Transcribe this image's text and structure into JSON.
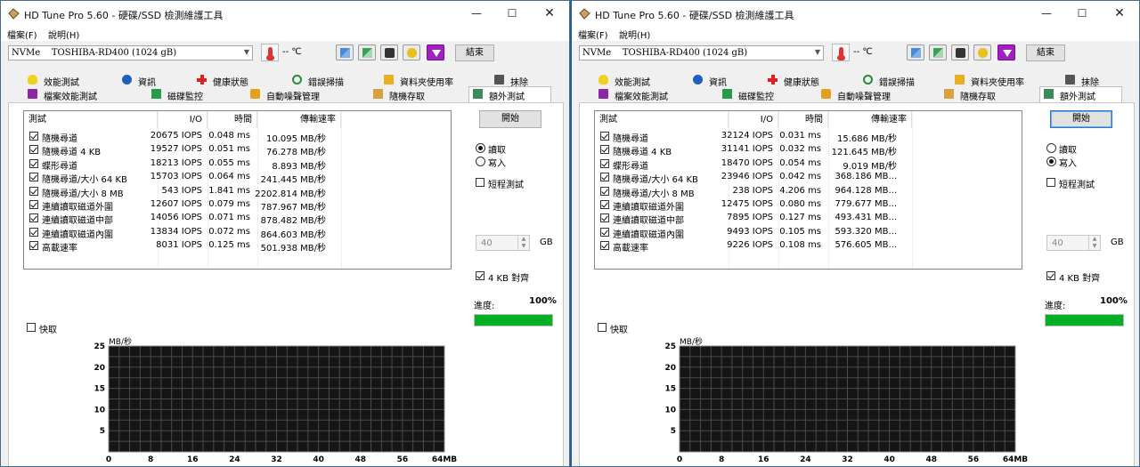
{
  "windows": [
    {
      "title": "HD Tune Pro 5.60 - 硬碟/SSD 檢測維護工具",
      "window_controls": {
        "minimize": "—",
        "maximize": "☐",
        "close": "✕"
      },
      "menu": [
        "檔案(F)",
        "說明(H)"
      ],
      "drive": "NVMe    TOSHIBA-RD400 (1024 gB)",
      "temperature": "-- ℃",
      "exit_label": "結束",
      "tabs_row1": [
        {
          "label": "效能測試",
          "icon": "bulb-icon"
        },
        {
          "label": "資訊",
          "icon": "info-icon"
        },
        {
          "label": "健康狀態",
          "icon": "health-cross-icon"
        },
        {
          "label": "錯誤掃描",
          "icon": "magnifier-icon"
        },
        {
          "label": "資料夾使用率",
          "icon": "folder-icon"
        },
        {
          "label": "抹除",
          "icon": "trash-icon"
        }
      ],
      "tabs_row2": [
        {
          "label": "檔案效能測試",
          "icon": "file-benchmark-icon"
        },
        {
          "label": "磁碟監控",
          "icon": "disk-monitor-icon"
        },
        {
          "label": "自動噪聲管理",
          "icon": "speaker-icon"
        },
        {
          "label": "隨機存取",
          "icon": "random-access-icon"
        },
        {
          "label": "額外測試",
          "icon": "extra-tests-icon",
          "active": true
        }
      ],
      "table": {
        "headers": [
          "測試",
          "I/O",
          "時間",
          "傳輸速率"
        ],
        "rows": [
          {
            "name": "隨機尋道",
            "io": "20675 IOPS",
            "time": "0.048 ms",
            "rate": "10.095 MB/秒",
            "checked": true
          },
          {
            "name": "隨機尋道 4 KB",
            "io": "19527 IOPS",
            "time": "0.051 ms",
            "rate": "76.278 MB/秒",
            "checked": true
          },
          {
            "name": "蝶形尋道",
            "io": "18213 IOPS",
            "time": "0.055 ms",
            "rate": "8.893 MB/秒",
            "checked": true
          },
          {
            "name": "隨機尋道/大小 64 KB",
            "io": "15703 IOPS",
            "time": "0.064 ms",
            "rate": "241.445 MB/秒",
            "checked": true
          },
          {
            "name": "隨機尋道/大小 8 MB",
            "io": "543 IOPS",
            "time": "1.841 ms",
            "rate": "2202.814 MB/秒",
            "checked": true
          },
          {
            "name": "連續讀取磁道外圍",
            "io": "12607 IOPS",
            "time": "0.079 ms",
            "rate": "787.967 MB/秒",
            "checked": true
          },
          {
            "name": "連續讀取磁道中部",
            "io": "14056 IOPS",
            "time": "0.071 ms",
            "rate": "878.482 MB/秒",
            "checked": true
          },
          {
            "name": "連續讀取磁道內圍",
            "io": "13834 IOPS",
            "time": "0.072 ms",
            "rate": "864.603 MB/秒",
            "checked": true
          },
          {
            "name": "高載速率",
            "io": "8031 IOPS",
            "time": "0.125 ms",
            "rate": "501.938 MB/秒",
            "checked": true
          }
        ]
      },
      "start_label": "開始",
      "start_focused": false,
      "read_label": "讀取",
      "write_label": "寫入",
      "mode": "read",
      "short_test_label": "短程測試",
      "short_test_checked": false,
      "size_value": "40",
      "size_unit": "GB",
      "align_label": "4 KB 對齊",
      "align_checked": true,
      "progress_label": "進度:",
      "progress_text": "100%",
      "progress_fraction": 1.0,
      "quick_label": "快取",
      "quick_checked": false,
      "chart_data": {
        "type": "line",
        "ylabel": "MB/秒",
        "xlabel": "",
        "x_tick_labels": [
          "0",
          "8",
          "16",
          "24",
          "32",
          "40",
          "48",
          "56",
          "64MB"
        ],
        "y_tick_labels": [
          "5",
          "10",
          "15",
          "20",
          "25"
        ],
        "ylim": [
          0,
          25
        ],
        "xlim": [
          0,
          64
        ],
        "grid": true,
        "series": []
      }
    },
    {
      "title": "HD Tune Pro 5.60 - 硬碟/SSD 檢測維護工具",
      "window_controls": {
        "minimize": "—",
        "maximize": "☐",
        "close": "✕"
      },
      "menu": [
        "檔案(F)",
        "說明(H)"
      ],
      "drive": "NVMe    TOSHIBA-RD400 (1024 gB)",
      "temperature": "-- ℃",
      "exit_label": "結束",
      "tabs_row1": [
        {
          "label": "效能測試",
          "icon": "bulb-icon"
        },
        {
          "label": "資訊",
          "icon": "info-icon"
        },
        {
          "label": "健康狀態",
          "icon": "health-cross-icon"
        },
        {
          "label": "錯誤掃描",
          "icon": "magnifier-icon"
        },
        {
          "label": "資料夾使用率",
          "icon": "folder-icon"
        },
        {
          "label": "抹除",
          "icon": "trash-icon"
        }
      ],
      "tabs_row2": [
        {
          "label": "檔案效能測試",
          "icon": "file-benchmark-icon"
        },
        {
          "label": "磁碟監控",
          "icon": "disk-monitor-icon"
        },
        {
          "label": "自動噪聲管理",
          "icon": "speaker-icon"
        },
        {
          "label": "隨機存取",
          "icon": "random-access-icon"
        },
        {
          "label": "額外測試",
          "icon": "extra-tests-icon",
          "active": true
        }
      ],
      "table": {
        "headers": [
          "測試",
          "I/O",
          "時間",
          "傳輸速率"
        ],
        "rows": [
          {
            "name": "隨機尋道",
            "io": "32124 IOPS",
            "time": "0.031 ms",
            "rate": "15.686 MB/秒",
            "checked": true
          },
          {
            "name": "隨機尋道 4 KB",
            "io": "31141 IOPS",
            "time": "0.032 ms",
            "rate": "121.645 MB/秒",
            "checked": true
          },
          {
            "name": "蝶形尋道",
            "io": "18470 IOPS",
            "time": "0.054 ms",
            "rate": "9.019 MB/秒",
            "checked": true
          },
          {
            "name": "隨機尋道/大小 64 KB",
            "io": "23946 IOPS",
            "time": "0.042 ms",
            "rate": "368.186 MB...",
            "checked": true
          },
          {
            "name": "隨機尋道/大小 8 MB",
            "io": "238 IOPS",
            "time": "4.206 ms",
            "rate": "964.128 MB...",
            "checked": true
          },
          {
            "name": "連續讀取磁道外圍",
            "io": "12475 IOPS",
            "time": "0.080 ms",
            "rate": "779.677 MB...",
            "checked": true
          },
          {
            "name": "連續讀取磁道中部",
            "io": "7895 IOPS",
            "time": "0.127 ms",
            "rate": "493.431 MB...",
            "checked": true
          },
          {
            "name": "連續讀取磁道內圍",
            "io": "9493 IOPS",
            "time": "0.105 ms",
            "rate": "593.320 MB...",
            "checked": true
          },
          {
            "name": "高載速率",
            "io": "9226 IOPS",
            "time": "0.108 ms",
            "rate": "576.605 MB...",
            "checked": true
          }
        ]
      },
      "start_label": "開始",
      "start_focused": true,
      "read_label": "讀取",
      "write_label": "寫入",
      "mode": "write",
      "short_test_label": "短程測試",
      "short_test_checked": false,
      "size_value": "40",
      "size_unit": "GB",
      "align_label": "4 KB 對齊",
      "align_checked": true,
      "progress_label": "進度:",
      "progress_text": "100%",
      "progress_fraction": 1.0,
      "quick_label": "快取",
      "quick_checked": false,
      "chart_data": {
        "type": "line",
        "ylabel": "MB/秒",
        "xlabel": "",
        "x_tick_labels": [
          "0",
          "8",
          "16",
          "24",
          "32",
          "40",
          "48",
          "56",
          "64MB"
        ],
        "y_tick_labels": [
          "5",
          "10",
          "15",
          "20",
          "25"
        ],
        "ylim": [
          0,
          25
        ],
        "xlim": [
          0,
          64
        ],
        "grid": true,
        "series": []
      }
    }
  ]
}
